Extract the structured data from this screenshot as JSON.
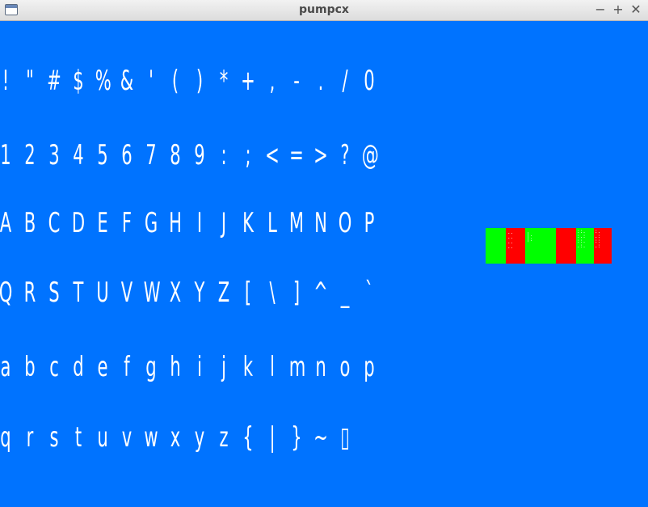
{
  "window": {
    "title": "pumpcx",
    "controls": {
      "minimize": "−",
      "maximize": "+",
      "close": "✕"
    },
    "icon": "window-icon"
  },
  "canvas": {
    "background": "#0073ff",
    "glyph_color": "#ffffff",
    "rows": [
      [
        "!",
        "\"",
        "#",
        "$",
        "%",
        "&",
        "'",
        "(",
        ")",
        "*",
        "+",
        ",",
        "-",
        ".",
        "/",
        "0"
      ],
      [
        "1",
        "2",
        "3",
        "4",
        "5",
        "6",
        "7",
        "8",
        "9",
        ":",
        ";",
        "<",
        "=",
        ">",
        "?",
        "@"
      ],
      [
        "A",
        "B",
        "C",
        "D",
        "E",
        "F",
        "G",
        "H",
        "I",
        "J",
        "K",
        "L",
        "M",
        "N",
        "O",
        "P"
      ],
      [
        "Q",
        "R",
        "S",
        "T",
        "U",
        "V",
        "W",
        "X",
        "Y",
        "Z",
        "[",
        "\\",
        "]",
        "^",
        "_",
        "`"
      ],
      [
        "a",
        "b",
        "c",
        "d",
        "e",
        "f",
        "g",
        "h",
        "i",
        "j",
        "k",
        "l",
        "m",
        "n",
        "o",
        "p"
      ],
      [
        "q",
        "r",
        "s",
        "t",
        "u",
        "v",
        "w",
        "x",
        "y",
        "z",
        "{",
        "|",
        "}",
        "~",
        "▯"
      ]
    ]
  },
  "status_strip": {
    "colors": {
      "green": "#00ff00",
      "red": "#ff0000"
    }
  }
}
